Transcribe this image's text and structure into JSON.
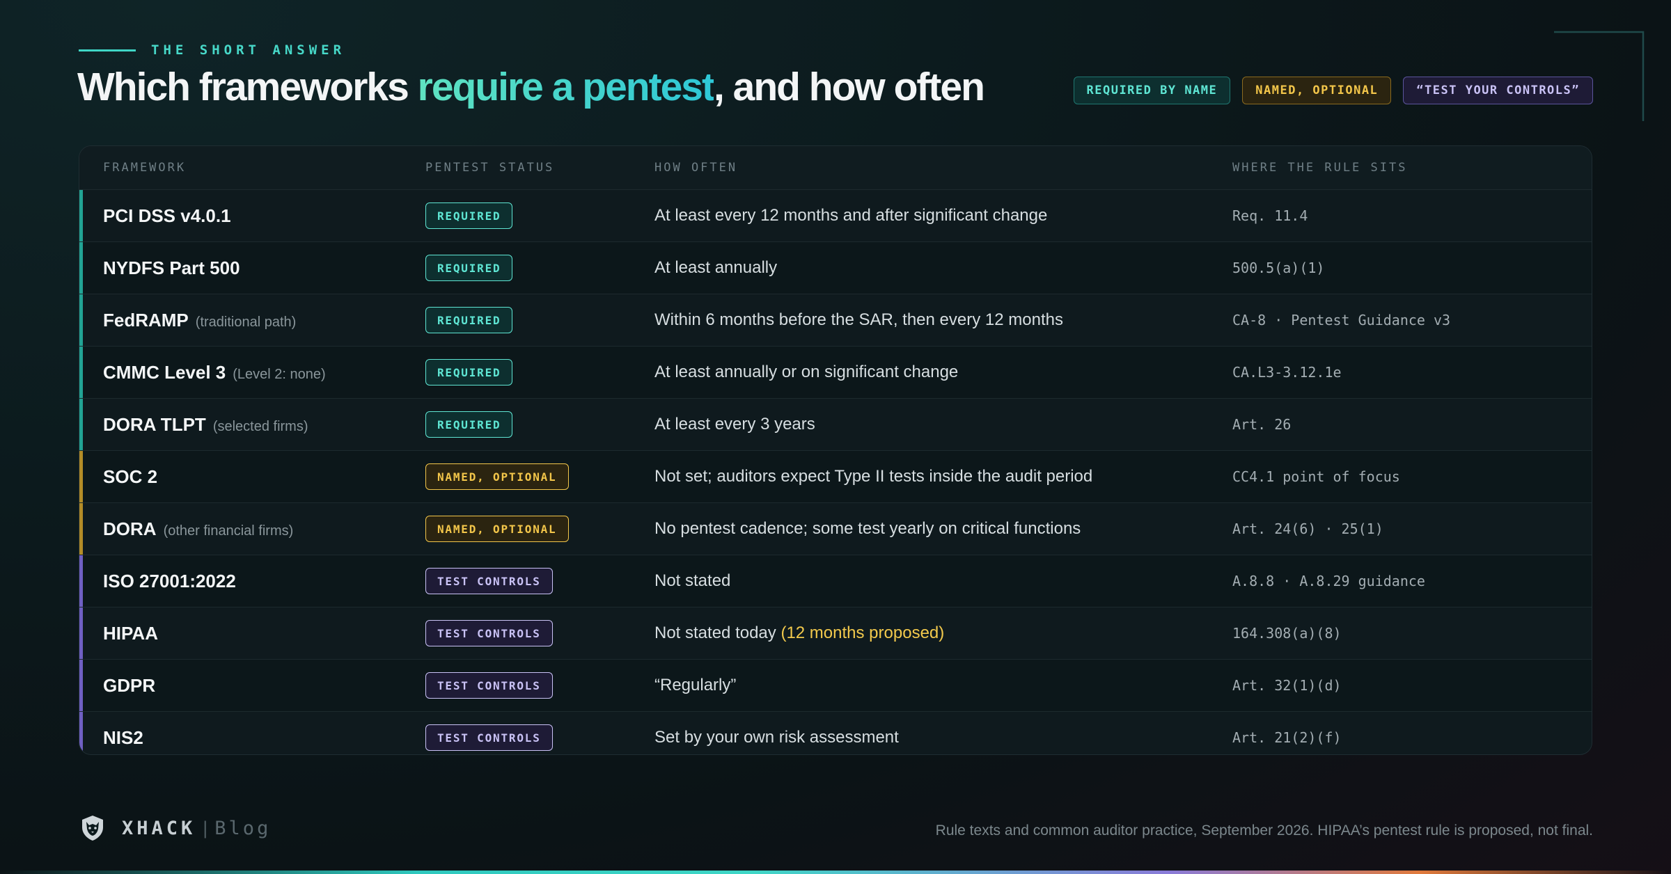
{
  "header": {
    "eyebrow": "THE SHORT ANSWER",
    "title_before": "Which frameworks ",
    "title_accent": "require a pentest",
    "title_after": ", and how often"
  },
  "legend": [
    {
      "label": "REQUIRED BY NAME",
      "kind": "teal"
    },
    {
      "label": "NAMED, OPTIONAL",
      "kind": "yellow"
    },
    {
      "label": "“TEST YOUR CONTROLS”",
      "kind": "violet"
    }
  ],
  "table": {
    "columns": [
      "FRAMEWORK",
      "PENTEST STATUS",
      "HOW OFTEN",
      "WHERE THE RULE SITS"
    ],
    "rows": [
      {
        "framework": "PCI DSS v4.0.1",
        "note": "",
        "status": "REQUIRED",
        "kind": "teal",
        "often": "At least every 12 months and after significant change",
        "often_highlight": "",
        "rule": "Req. 11.4"
      },
      {
        "framework": "NYDFS Part 500",
        "note": "",
        "status": "REQUIRED",
        "kind": "teal",
        "often": "At least annually",
        "often_highlight": "",
        "rule": "500.5(a)(1)"
      },
      {
        "framework": "FedRAMP",
        "note": "(traditional path)",
        "status": "REQUIRED",
        "kind": "teal",
        "often": "Within 6 months before the SAR, then every 12 months",
        "often_highlight": "",
        "rule": "CA-8 · Pentest Guidance v3"
      },
      {
        "framework": "CMMC Level 3",
        "note": "(Level 2: none)",
        "status": "REQUIRED",
        "kind": "teal",
        "often": "At least annually or on significant change",
        "often_highlight": "",
        "rule": "CA.L3-3.12.1e"
      },
      {
        "framework": "DORA TLPT",
        "note": "(selected firms)",
        "status": "REQUIRED",
        "kind": "teal",
        "often": "At least every 3 years",
        "often_highlight": "",
        "rule": "Art. 26"
      },
      {
        "framework": "SOC 2",
        "note": "",
        "status": "NAMED, OPTIONAL",
        "kind": "yellow",
        "often": "Not set; auditors expect Type II tests inside the audit period",
        "often_highlight": "",
        "rule": "CC4.1 point of focus"
      },
      {
        "framework": "DORA",
        "note": "(other financial firms)",
        "status": "NAMED, OPTIONAL",
        "kind": "yellow",
        "often": "No pentest cadence; some test yearly on critical functions",
        "often_highlight": "",
        "rule": "Art. 24(6) · 25(1)"
      },
      {
        "framework": "ISO 27001:2022",
        "note": "",
        "status": "TEST CONTROLS",
        "kind": "violet",
        "often": "Not stated",
        "often_highlight": "",
        "rule": "A.8.8 · A.8.29 guidance"
      },
      {
        "framework": "HIPAA",
        "note": "",
        "status": "TEST CONTROLS",
        "kind": "violet",
        "often": "Not stated today ",
        "often_highlight": "(12 months proposed)",
        "rule": "164.308(a)(8)"
      },
      {
        "framework": "GDPR",
        "note": "",
        "status": "TEST CONTROLS",
        "kind": "violet",
        "often": "“Regularly”",
        "often_highlight": "",
        "rule": "Art. 32(1)(d)"
      },
      {
        "framework": "NIS2",
        "note": "",
        "status": "TEST CONTROLS",
        "kind": "violet",
        "often": "Set by your own risk assessment",
        "often_highlight": "",
        "rule": "Art. 21(2)(f)"
      }
    ]
  },
  "footer": {
    "brand": "XHACK",
    "separator": "|",
    "section": "Blog",
    "note": "Rule texts and common auditor practice, September 2026. HIPAA’s pentest rule is proposed, not final."
  },
  "colors": {
    "teal": "#5fe6d4",
    "yellow": "#f3c64a",
    "violet": "#c9c2f5",
    "background": "#0c1a1d"
  },
  "icons": {
    "brand": "wolf-shield-icon"
  }
}
